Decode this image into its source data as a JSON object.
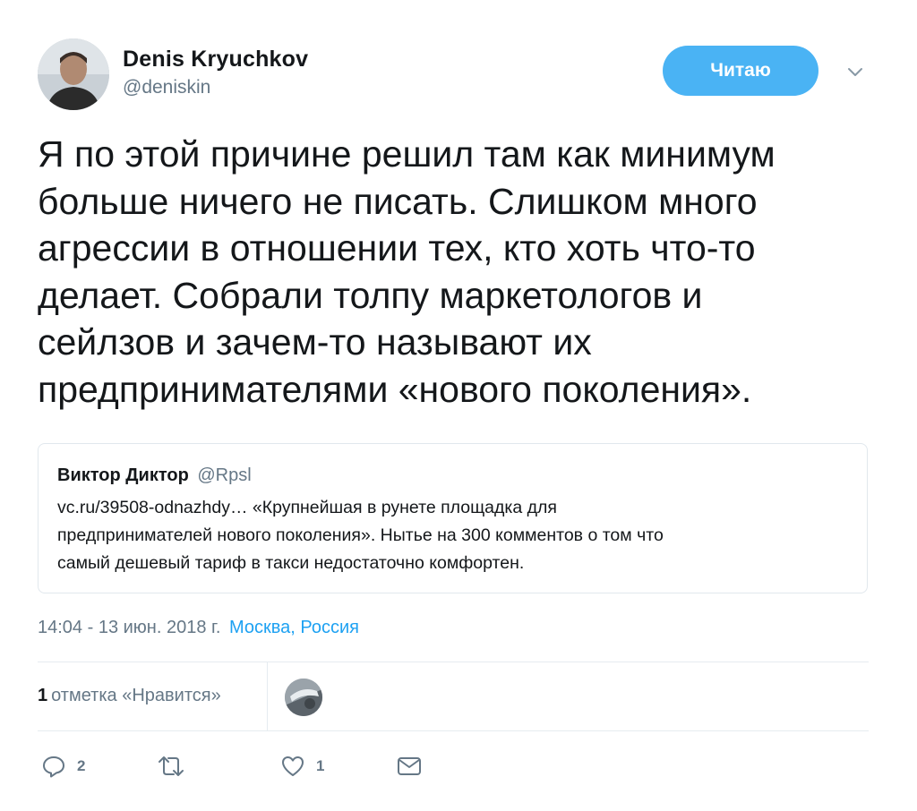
{
  "author": {
    "name": "Denis Kryuchkov",
    "handle": "@deniskin",
    "avatar_icon": "user-photo"
  },
  "follow_button": {
    "label": "Читаю"
  },
  "menu_icon": "chevron-down-icon",
  "tweet": {
    "lines": [
      "Я по этой причине решил там как минимум",
      "больше ничего не писать. Слишком много",
      "агрессии в отношении тех, кто хоть что-то",
      "делает. Собрали толпу маркетологов и",
      "сейлзов и зачем-то называют их",
      "предпринимателями «нового поколения»."
    ]
  },
  "quote": {
    "name": "Виктор Диктор",
    "handle": "@Rpsl",
    "lines": [
      "vc.ru/39508-odnazhdy… «Крупнейшая в рунете площадка для",
      "предпринимателей нового поколения». Нытье на 300 комментов о том что",
      "самый дешевый тариф в такси недостаточно комфортен."
    ]
  },
  "meta": {
    "timestamp": "14:04 - 13 июн. 2018 г.",
    "location": "Москва, Россия"
  },
  "stats": {
    "likes_count": "1",
    "likes_label": "отметка «Нравится»"
  },
  "actions": {
    "reply_count": "2",
    "retweet_count": "",
    "like_count": "1"
  },
  "colors": {
    "accent": "#1da1f2",
    "follow_bg": "#4ab3f4",
    "secondary_text": "#657786",
    "border": "#e1e8ed"
  }
}
